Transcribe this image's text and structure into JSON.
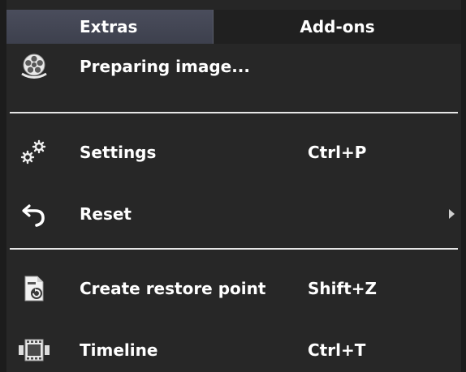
{
  "menubar": {
    "tabs": [
      {
        "label": "Extras",
        "active": true
      },
      {
        "label": "Add-ons",
        "active": false
      }
    ]
  },
  "menu": {
    "items": [
      {
        "icon": "film-reel-icon",
        "label": "Preparing image...",
        "shortcut": ""
      },
      {
        "icon": "gears-icon",
        "label": "Settings",
        "shortcut": "Ctrl+P"
      },
      {
        "icon": "undo-arrow-icon",
        "label": "Reset",
        "shortcut": "",
        "submenu": true
      },
      {
        "icon": "restore-point-icon",
        "label": "Create restore point",
        "shortcut": "Shift+Z"
      },
      {
        "icon": "timeline-icon",
        "label": "Timeline",
        "shortcut": "Ctrl+T"
      }
    ]
  },
  "colors": {
    "menubar_background": "#1c1c1c",
    "active_tab_background": "#45485a",
    "menu_background": "#272727",
    "separator": "#e6e6e6",
    "text": "#ffffff"
  }
}
